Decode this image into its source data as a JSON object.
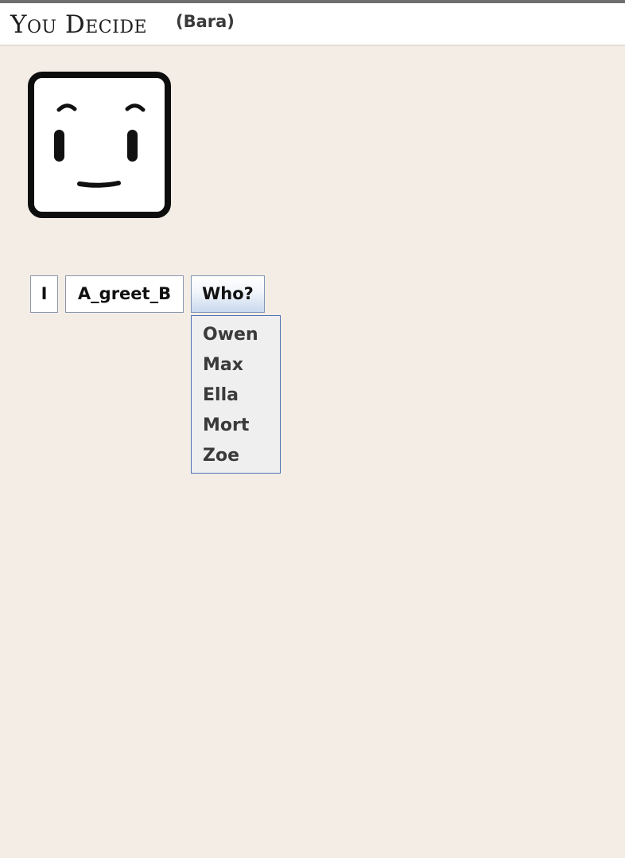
{
  "header": {
    "logo_text": "You Decide",
    "player_name": "(Bara)"
  },
  "avatar": {
    "icon": "square-face-neutral-icon"
  },
  "sentence": {
    "tokens": [
      {
        "label": "I"
      },
      {
        "label": "A_greet_B"
      },
      {
        "label": "Who?"
      }
    ]
  },
  "dropdown": {
    "options": [
      "Owen",
      "Max",
      "Ella",
      "Mort",
      "Zoe"
    ]
  }
}
